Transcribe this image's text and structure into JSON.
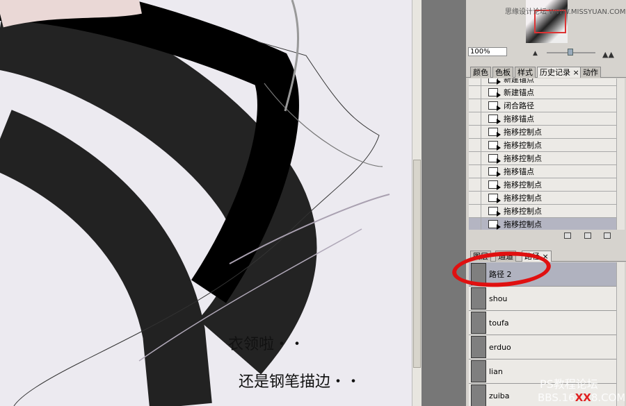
{
  "canvas": {
    "caption1": "衣领啦・・",
    "caption2": "还是钢笔描边・・"
  },
  "navigator": {
    "watermark": "思缘设计论坛 WWW.MISSYUAN.COM",
    "zoom": "100%"
  },
  "history_panel": {
    "tabs": [
      "颜色",
      "色板",
      "样式",
      "历史记录",
      "动作"
    ],
    "active_tab": "历史记录",
    "items": [
      "新建锚点",
      "新建锚点",
      "闭合路径",
      "拖移锚点",
      "拖移控制点",
      "拖移控制点",
      "拖移控制点",
      "拖移锚点",
      "拖移控制点",
      "拖移控制点",
      "拖移控制点",
      "拖移控制点"
    ],
    "selected_index": 11
  },
  "paths_panel": {
    "tabs": [
      "图层",
      "通道",
      "路径"
    ],
    "active_tab": "路径",
    "items": [
      "路径 2",
      "shou",
      "toufa",
      "erduo",
      "lian",
      "zuiba"
    ],
    "selected_index": 0
  },
  "watermark": {
    "line1": "PS教程论坛",
    "line2a": "BBS.16",
    "line2b": "XX",
    "line2c": "8.COM"
  },
  "colors": {
    "annotation": "#e01010",
    "selection": "#b0b2bf"
  }
}
